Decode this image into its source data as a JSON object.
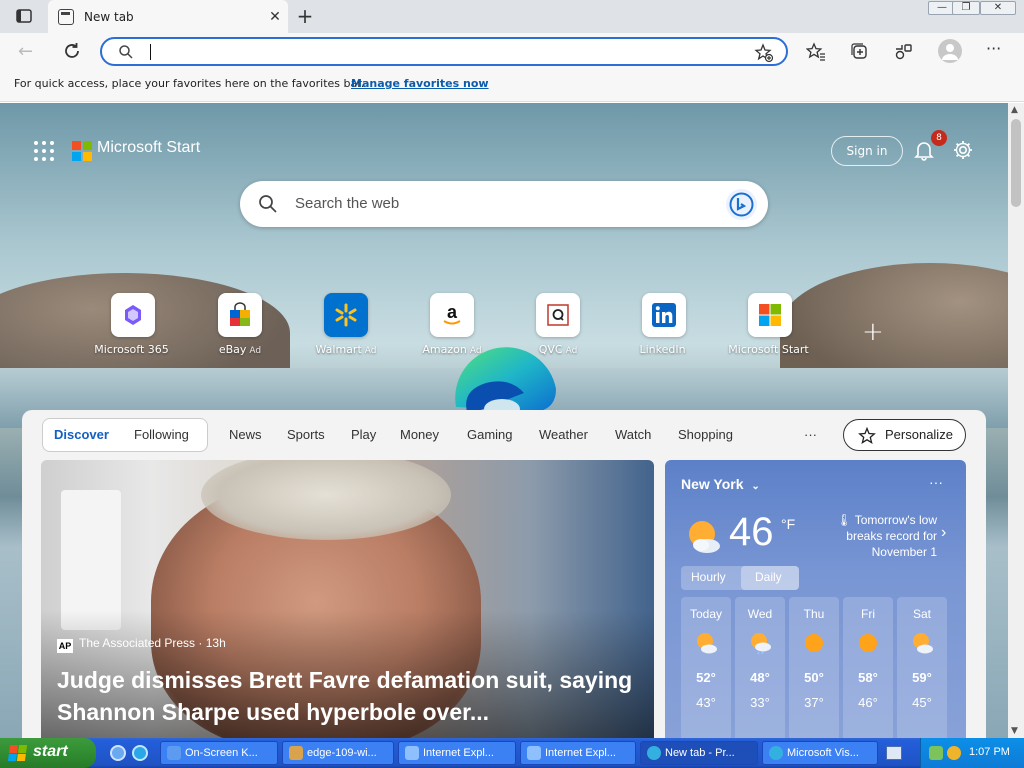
{
  "browser": {
    "tab_title": "New tab",
    "tab_close": "✕",
    "new_tab": "+",
    "window_min": "—",
    "window_max": "❐",
    "window_close": "✕",
    "address_value": "",
    "favbar_text": "For quick access, place your favorites here on the favorites bar.",
    "favbar_link": "Manage favorites now"
  },
  "start": {
    "brand": "Microsoft Start",
    "sign_in": "Sign in",
    "notification_count": "8",
    "search_placeholder": "Search the web",
    "tiles": [
      {
        "label": "Microsoft 365",
        "ad": ""
      },
      {
        "label": "eBay",
        "ad": "Ad"
      },
      {
        "label": "Walmart",
        "ad": "Ad"
      },
      {
        "label": "Amazon",
        "ad": "Ad"
      },
      {
        "label": "QVC",
        "ad": "Ad"
      },
      {
        "label": "LinkedIn",
        "ad": ""
      },
      {
        "label": "Microsoft Start",
        "ad": ""
      }
    ],
    "feed_tabs": [
      "Discover",
      "Following",
      "News",
      "Sports",
      "Play",
      "Money",
      "Gaming",
      "Weather",
      "Watch",
      "Shopping"
    ],
    "more": "···",
    "personalize": "Personalize"
  },
  "hero": {
    "source_logo": "AP",
    "source": "The Associated Press · 13h",
    "headline": "Judge dismisses Brett Favre defamation suit, saying Shannon Sharpe used hyperbole over..."
  },
  "weather": {
    "city": "New York",
    "more": "···",
    "temp": "46",
    "unit": "°F",
    "note": "Tomorrow's low breaks record for November 1",
    "tab_hourly": "Hourly",
    "tab_daily": "Daily",
    "days": [
      {
        "name": "Today",
        "hi": "52°",
        "lo": "43°",
        "icon": "partly-cloudy"
      },
      {
        "name": "Wed",
        "hi": "48°",
        "lo": "33°",
        "icon": "rain-sun"
      },
      {
        "name": "Thu",
        "hi": "50°",
        "lo": "37°",
        "icon": "sunny"
      },
      {
        "name": "Fri",
        "hi": "58°",
        "lo": "46°",
        "icon": "sunny"
      },
      {
        "name": "Sat",
        "hi": "59°",
        "lo": "45°",
        "icon": "partly-cloudy"
      }
    ]
  },
  "taskbar": {
    "start": "start",
    "tasks": [
      "On-Screen K...",
      "edge-109-wi...",
      "Internet Expl...",
      "Internet Expl...",
      "New tab - Pr...",
      "Microsoft Vis..."
    ],
    "clock": "1:07 PM"
  },
  "colors": {
    "accent": "#2b6fd6",
    "link": "#0b5cad",
    "badge": "#c42b1c",
    "xp_blue": "#245edb",
    "xp_green": "#2f8a2f"
  }
}
